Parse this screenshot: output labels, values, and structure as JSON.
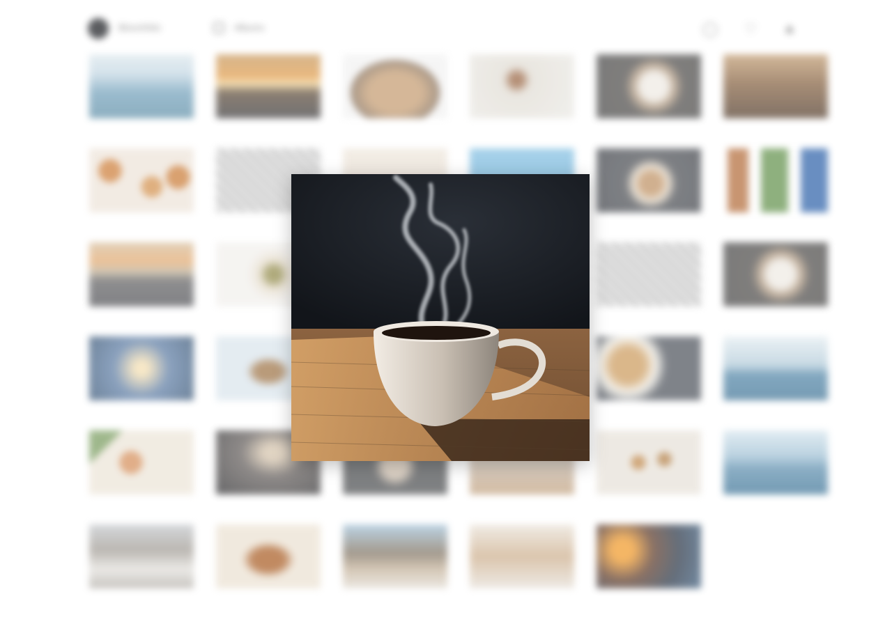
{
  "app": {
    "name": "Bloomfolio",
    "album_label": "Albums"
  },
  "toolbar": {
    "icons": [
      "search-icon",
      "heart-icon",
      "user-icon"
    ]
  },
  "gallery": {
    "tiles": [
      "sky",
      "sunset",
      "cat",
      "deer",
      "latte",
      "dune",
      "pastry",
      "pattern",
      "paper",
      "blue",
      "bowl",
      "cards",
      "horizon",
      "plate",
      "blank",
      "blank",
      "pattern",
      "latte",
      "sunrise",
      "dog",
      "blank",
      "blank",
      "soup",
      "sea",
      "food",
      "dark",
      "dish",
      "misc",
      "beans",
      "pier",
      "cliff",
      "bread",
      "mount",
      "desert",
      "fire"
    ]
  },
  "lightbox": {
    "subject": "steaming-coffee-cup"
  }
}
